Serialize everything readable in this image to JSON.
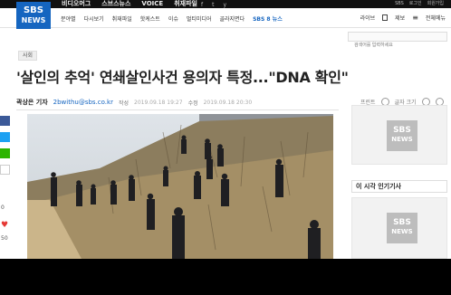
{
  "logo": {
    "line1": "SBS",
    "line2": "NEWS"
  },
  "topbar": {
    "nav": [
      "비디오머그",
      "스브스뉴스",
      "VOICE",
      "취재파일"
    ],
    "social": [
      "f",
      "t",
      "y"
    ],
    "login": [
      "SBS",
      "로그인",
      "회원가입"
    ]
  },
  "nav": {
    "items": [
      "분야별",
      "다시보기",
      "취재파일",
      "핫케스트",
      "이슈",
      "멀티미디어",
      "골라지면다"
    ],
    "sbs8": "SBS 8 뉴스",
    "right": [
      "라이브",
      "제보",
      "전체메뉴"
    ]
  },
  "search": {
    "placeholder": "검색어를 입력하세요"
  },
  "article": {
    "category": "사회",
    "title": "'살인의 추억' 연쇄살인사건 용의자 특정...\"DNA 확인\"",
    "reporter": "곽상은 기자",
    "email": "2bwithu@sbs.co.kr",
    "written_label": "작성",
    "written_date": "2019.09.18 19:27",
    "edited_label": "수정",
    "edited_date": "2019.09.18 20:30",
    "tools": [
      "프린트",
      "글자 크기"
    ]
  },
  "share": {
    "counts": [
      "0",
      "50"
    ]
  },
  "rail": {
    "ad_logo_line1": "SBS",
    "ad_logo_line2": "NEWS",
    "popular_title": "이 시각 인기기사"
  },
  "colors": {
    "brand": "#1565c0",
    "facebook": "#3b5998",
    "twitter": "#1da1f2",
    "naver": "#2db400"
  }
}
